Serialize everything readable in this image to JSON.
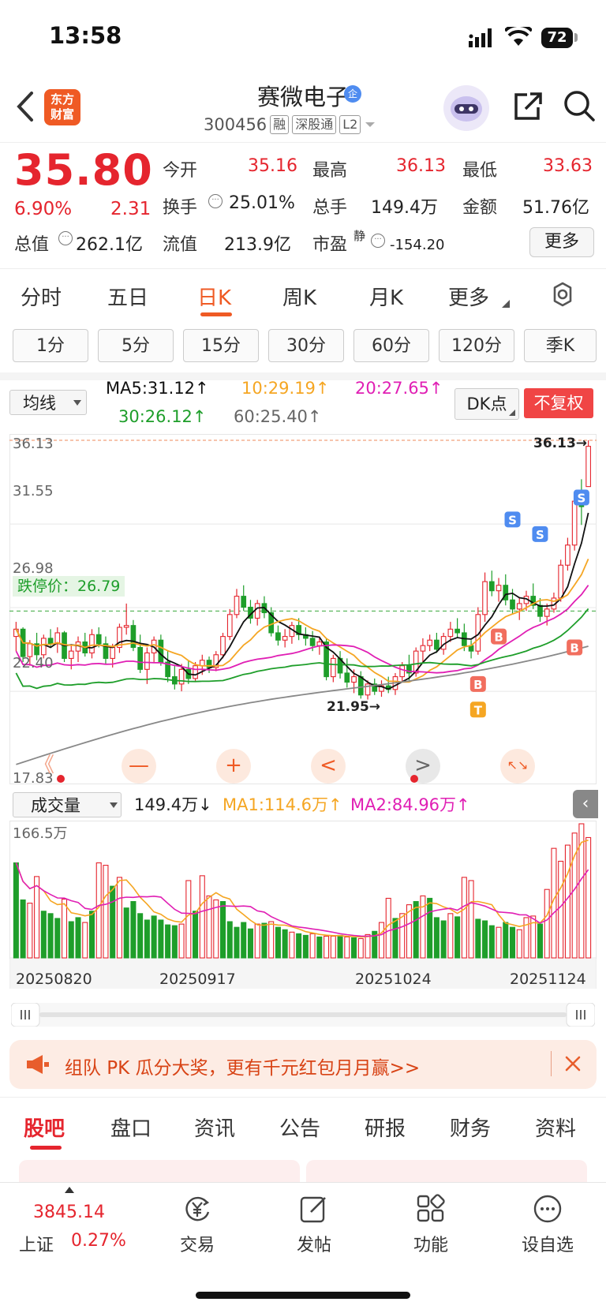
{
  "status_bar": {
    "time": "13:58",
    "battery": "72"
  },
  "header": {
    "logo_line1": "东方",
    "logo_line2": "财富",
    "stock_name": "赛微电子",
    "badge": "企",
    "stock_code": "300456",
    "tags": [
      "融",
      "深股通",
      "L2"
    ]
  },
  "quote": {
    "price": "35.80",
    "change_pct": "6.90%",
    "change_amt": "2.31",
    "open_label": "今开",
    "open": "35.16",
    "high_label": "最高",
    "high": "36.13",
    "low_label": "最低",
    "low": "33.63",
    "turnover_label": "换手",
    "turnover": "25.01%",
    "volume_label": "总手",
    "volume": "149.4万",
    "amount_label": "金额",
    "amount": "51.76亿",
    "mktcap_label": "总值",
    "mktcap": "262.1亿",
    "float_label": "流值",
    "float_cap": "213.9亿",
    "pe_label": "市盈",
    "pe_sup": "静",
    "pe": "-154.20",
    "more": "更多"
  },
  "period_tabs": [
    "分时",
    "五日",
    "日K",
    "周K",
    "月K",
    "更多"
  ],
  "active_period": "日K",
  "minute_buttons": [
    "1分",
    "5分",
    "15分",
    "30分",
    "60分",
    "120分",
    "季K"
  ],
  "ma_row": {
    "select": "均线",
    "ma5": "MA5:31.12↑",
    "ma10": "10:29.19↑",
    "ma20": "20:27.65↑",
    "ma30": "30:26.12↑",
    "ma60": "60:25.40↑",
    "dk": "DK点",
    "fq": "不复权"
  },
  "colors": {
    "up": "#e5252e",
    "down": "#1e9e2a",
    "accent": "#ef5a24",
    "ma5": "#111111",
    "ma10": "#f5a623",
    "ma20": "#e01fb4",
    "ma30": "#1e9e2a",
    "ma60": "#888888"
  },
  "chart_data": [
    {
      "type": "candlestick",
      "y_axis_labels": [
        "36.13",
        "31.55",
        "26.98",
        "22.40",
        "17.83"
      ],
      "ylim": [
        17.83,
        36.13
      ],
      "limit_down_label": "跌停价：26.79",
      "limit_down": 26.79,
      "max_label": "36.13→",
      "min_label": "21.95→",
      "signals": [
        "S",
        "S",
        "S",
        "B",
        "B",
        "B",
        "T"
      ],
      "ohlc": [
        [
          25.4,
          26.2,
          24.6,
          25.8
        ],
        [
          25.8,
          25.9,
          24.0,
          24.3
        ],
        [
          24.3,
          25.2,
          23.8,
          25.0
        ],
        [
          25.0,
          25.6,
          24.1,
          24.4
        ],
        [
          24.4,
          25.5,
          24.2,
          25.3
        ],
        [
          25.3,
          25.8,
          24.8,
          25.0
        ],
        [
          25.0,
          25.9,
          24.5,
          25.6
        ],
        [
          25.6,
          25.7,
          24.0,
          24.2
        ],
        [
          24.2,
          24.9,
          23.6,
          24.6
        ],
        [
          24.6,
          25.4,
          24.0,
          25.1
        ],
        [
          25.1,
          25.6,
          24.3,
          24.5
        ],
        [
          24.5,
          25.8,
          24.2,
          25.5
        ],
        [
          25.5,
          25.9,
          24.8,
          25.0
        ],
        [
          25.0,
          25.4,
          23.9,
          24.2
        ],
        [
          24.2,
          25.0,
          23.7,
          24.8
        ],
        [
          24.8,
          26.1,
          24.5,
          25.9
        ],
        [
          25.9,
          27.2,
          25.5,
          26.0
        ],
        [
          26.0,
          26.3,
          24.6,
          24.8
        ],
        [
          24.8,
          25.5,
          23.4,
          23.6
        ],
        [
          23.6,
          24.8,
          22.8,
          24.5
        ],
        [
          24.5,
          25.4,
          24.0,
          25.2
        ],
        [
          25.2,
          25.5,
          23.8,
          24.0
        ],
        [
          24.0,
          24.6,
          22.9,
          23.2
        ],
        [
          23.2,
          23.8,
          22.5,
          22.8
        ],
        [
          22.8,
          23.9,
          22.4,
          23.6
        ],
        [
          23.6,
          24.1,
          22.8,
          23.1
        ],
        [
          23.1,
          24.0,
          22.9,
          23.8
        ],
        [
          23.8,
          24.4,
          23.3,
          24.1
        ],
        [
          24.1,
          24.3,
          23.4,
          23.7
        ],
        [
          23.7,
          24.6,
          23.5,
          24.4
        ],
        [
          24.4,
          25.6,
          24.2,
          25.4
        ],
        [
          25.4,
          26.9,
          25.2,
          26.6
        ],
        [
          26.6,
          28.0,
          26.4,
          27.6
        ],
        [
          27.6,
          28.2,
          26.8,
          27.0
        ],
        [
          27.0,
          27.4,
          26.1,
          26.4
        ],
        [
          26.4,
          27.4,
          26.0,
          27.2
        ],
        [
          27.2,
          27.6,
          26.4,
          26.7
        ],
        [
          26.7,
          27.0,
          25.4,
          25.6
        ],
        [
          25.6,
          26.0,
          24.9,
          25.2
        ],
        [
          25.2,
          25.8,
          24.8,
          25.4
        ],
        [
          25.4,
          26.2,
          25.0,
          26.0
        ],
        [
          26.0,
          26.4,
          25.2,
          25.5
        ],
        [
          25.5,
          25.9,
          24.9,
          25.3
        ],
        [
          25.3,
          25.7,
          24.6,
          24.9
        ],
        [
          24.9,
          25.4,
          24.4,
          25.1
        ],
        [
          25.1,
          25.3,
          23.0,
          23.2
        ],
        [
          23.2,
          24.4,
          22.9,
          24.2
        ],
        [
          24.2,
          24.6,
          23.1,
          23.4
        ],
        [
          23.4,
          24.2,
          22.6,
          22.9
        ],
        [
          22.9,
          23.6,
          22.3,
          23.2
        ],
        [
          23.2,
          23.5,
          22.0,
          22.2
        ],
        [
          22.2,
          23.0,
          21.95,
          22.8
        ],
        [
          22.8,
          23.1,
          22.2,
          22.4
        ],
        [
          22.4,
          23.0,
          22.1,
          22.7
        ],
        [
          22.7,
          23.2,
          22.3,
          22.5
        ],
        [
          22.5,
          23.4,
          22.2,
          23.2
        ],
        [
          23.2,
          24.0,
          22.9,
          23.8
        ],
        [
          23.8,
          24.4,
          23.0,
          23.4
        ],
        [
          23.4,
          24.8,
          23.2,
          24.6
        ],
        [
          24.6,
          25.3,
          24.0,
          24.9
        ],
        [
          24.9,
          25.5,
          24.6,
          25.2
        ],
        [
          25.2,
          25.6,
          24.5,
          24.7
        ],
        [
          24.7,
          25.6,
          24.4,
          25.4
        ],
        [
          25.4,
          26.2,
          25.1,
          25.8
        ],
        [
          25.8,
          26.4,
          25.3,
          25.6
        ],
        [
          25.6,
          26.1,
          24.6,
          24.9
        ],
        [
          24.9,
          25.2,
          24.2,
          24.6
        ],
        [
          24.6,
          27.0,
          24.4,
          26.6
        ],
        [
          26.6,
          28.9,
          26.2,
          28.4
        ],
        [
          28.4,
          29.0,
          27.6,
          27.9
        ],
        [
          27.9,
          28.6,
          27.3,
          28.2
        ],
        [
          28.2,
          28.8,
          27.1,
          27.4
        ],
        [
          27.4,
          28.0,
          26.6,
          26.9
        ],
        [
          26.9,
          27.5,
          26.3,
          27.2
        ],
        [
          27.2,
          27.9,
          26.8,
          27.6
        ],
        [
          27.6,
          28.3,
          26.9,
          27.1
        ],
        [
          27.1,
          27.5,
          26.2,
          26.5
        ],
        [
          26.5,
          27.2,
          26.0,
          26.9
        ],
        [
          26.9,
          27.8,
          26.7,
          27.5
        ],
        [
          27.5,
          29.6,
          27.3,
          29.3
        ],
        [
          29.3,
          30.8,
          29.0,
          30.4
        ],
        [
          30.4,
          33.2,
          30.1,
          32.8
        ],
        [
          32.8,
          34.0,
          31.5,
          32.5
        ],
        [
          33.6,
          36.13,
          33.63,
          35.8
        ]
      ]
    },
    {
      "type": "bar",
      "name": "成交量",
      "title_value": "149.4万↓",
      "ma1": "MA1:114.6万↑",
      "ma2": "MA2:84.96万↑",
      "y_axis_label": "166.5万",
      "ymax": 166.5,
      "x_tick_labels": [
        "20250820",
        "20250917",
        "20251024",
        "20251124"
      ],
      "values": [
        118,
        72,
        68,
        101,
        58,
        55,
        49,
        73,
        45,
        50,
        44,
        58,
        118,
        115,
        89,
        100,
        62,
        70,
        55,
        47,
        52,
        47,
        41,
        40,
        42,
        96,
        58,
        102,
        77,
        72,
        70,
        45,
        38,
        44,
        36,
        42,
        43,
        45,
        38,
        35,
        32,
        30,
        28,
        30,
        26,
        27,
        27,
        28,
        26,
        25,
        24,
        29,
        33,
        44,
        74,
        49,
        55,
        66,
        70,
        77,
        74,
        50,
        46,
        55,
        51,
        100,
        96,
        48,
        46,
        40,
        38,
        44,
        38,
        35,
        50,
        52,
        42,
        85,
        136,
        120,
        140,
        155,
        166.5,
        149.4
      ],
      "up_flags": [
        0,
        0,
        1,
        1,
        0,
        0,
        0,
        1,
        0,
        0,
        1,
        0,
        1,
        1,
        0,
        1,
        0,
        0,
        0,
        0,
        0,
        0,
        0,
        0,
        1,
        1,
        0,
        1,
        1,
        1,
        0,
        0,
        0,
        0,
        0,
        1,
        0,
        1,
        0,
        0,
        1,
        0,
        0,
        1,
        0,
        1,
        1,
        0,
        1,
        0,
        1,
        1,
        0,
        1,
        1,
        0,
        1,
        1,
        0,
        1,
        0,
        0,
        0,
        1,
        0,
        1,
        1,
        0,
        0,
        0,
        1,
        0,
        0,
        1,
        1,
        1,
        0,
        1,
        1,
        1,
        1,
        1,
        1,
        1
      ]
    }
  ],
  "chart_controls": [
    "《",
    "—",
    "+",
    "<",
    ">",
    "↖↘"
  ],
  "volume_select": "成交量",
  "banner": {
    "text": "组队 PK 瓜分大奖，更有千元红包月月赢>>"
  },
  "bottom_tabs": [
    "股吧",
    "盘口",
    "资讯",
    "公告",
    "研报",
    "财务",
    "资料"
  ],
  "active_bottom_tab": "股吧",
  "nav": {
    "index_value": "3845.14",
    "index_name": "上证",
    "index_change": "0.27%",
    "items": [
      "交易",
      "发帖",
      "功能",
      "设自选"
    ]
  }
}
